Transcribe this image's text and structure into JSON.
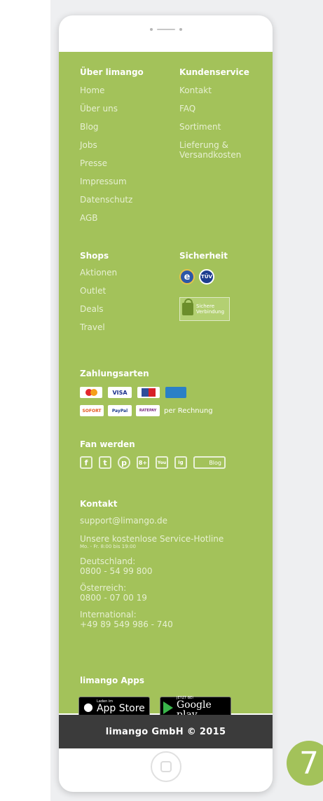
{
  "about": {
    "heading": "Über limango",
    "links": [
      "Home",
      "Über uns",
      "Blog",
      "Jobs",
      "Presse",
      "Impressum",
      "Datenschutz",
      "AGB"
    ]
  },
  "service": {
    "heading": "Kundenservice",
    "links": [
      "Kontakt",
      "FAQ",
      "Sortiment",
      "Lieferung & Versandkosten"
    ]
  },
  "shops": {
    "heading": "Shops",
    "links": [
      "Aktionen",
      "Outlet",
      "Deals",
      "Travel"
    ]
  },
  "security": {
    "heading": "Sicherheit",
    "tuv_label": "TÜV",
    "ssl_text_1": "Sichere",
    "ssl_text_2": "Verbindung",
    "ssl_label": "SSL"
  },
  "payment": {
    "heading": "Zahlungsarten",
    "visa": "VISA",
    "sofort": "SOFORT",
    "paypal": "PayPal",
    "ratepay": "RATEPAY",
    "invoice": "per Rechnung"
  },
  "fan": {
    "heading": "Fan werden",
    "icons": [
      "f",
      "t",
      "p",
      "8+",
      "You",
      "ig"
    ],
    "blog_label": "Blog"
  },
  "contact": {
    "heading": "Kontakt",
    "email": "support@limango.de",
    "hotline": "Unsere kostenlose Service-Hotline",
    "hours": "Mo. - Fr. 8:00 bis 19:00",
    "de_label": "Deutschland:",
    "de_number": "0800 - 54 99 800",
    "at_label": "Österreich:",
    "at_number": "0800 - 07 00 19",
    "int_label": "International:",
    "int_number": "+49 89 549 986 - 740"
  },
  "apps": {
    "heading": "limango Apps",
    "appstore_small": "Laden im",
    "appstore_big": "App Store",
    "google_small": "JETZT BEI",
    "google_big": "Google play"
  },
  "footer": {
    "copyright": "limango GmbH © 2015"
  },
  "badge": {
    "number": "7"
  },
  "colors": {
    "screen_green": "#a3c25a",
    "footer_dark": "#3b3b3b"
  }
}
